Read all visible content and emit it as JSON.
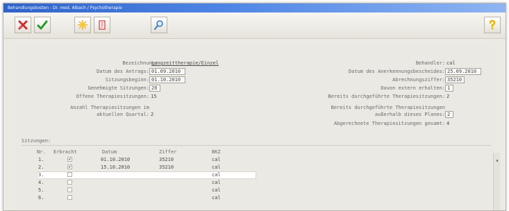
{
  "window": {
    "title": "Behandlungskosten - Dr. med. Albach / Psychotherapie"
  },
  "toolbar": {
    "buttons": [
      {
        "name": "delete-button",
        "icon": "red-x-icon"
      },
      {
        "name": "confirm-button",
        "icon": "green-check-icon"
      },
      {
        "name": "new-button",
        "icon": "yellow-burst-icon"
      },
      {
        "name": "print-button",
        "icon": "red-document-icon"
      },
      {
        "name": "search-button",
        "icon": "magnifier-icon"
      },
      {
        "name": "help-button",
        "icon": "question-mark-icon"
      }
    ]
  },
  "form": {
    "bezeichnung": {
      "label": "Bezeichnung:",
      "value": "Langzeittherapie/Einzel"
    },
    "datum_antrag": {
      "label": "Datum des Antrags:",
      "value": "01.09.2010"
    },
    "sitzungsbeginn": {
      "label": "Sitzungsbeginn:",
      "value": "01.10.2010"
    },
    "genehmigte": {
      "label": "Genehmigte Sitzungen:",
      "value": "20"
    },
    "offene": {
      "label": "Offene Therapiesitzungen:",
      "value": "15"
    },
    "anzahl_quartal": {
      "label_line1": "Anzahl Therapiesitzungen im",
      "label_line2": "aktuellen Quartal:",
      "value": "2"
    },
    "behandler": {
      "label": "Behandler:",
      "value": "cal"
    },
    "datum_anerkennung": {
      "label": "Datum des Anerkennungsbescheides:",
      "value": "25.09.2010"
    },
    "abrechnungsziffer": {
      "label": "Abrechnungsziffer:",
      "value": "35210"
    },
    "davon_extern": {
      "label": "Davon extern erhalten:",
      "value": "1"
    },
    "bereits_durchgefuehrt": {
      "label": "Bereits durchgeführte Therapiesitzungen:",
      "value": "2"
    },
    "ausserhalb": {
      "label_line1": "Bereits durchgeführte Therapiesitzungen",
      "label_line2": "außerhalb dieses Planes:",
      "value": "2"
    },
    "abgerechnet": {
      "label": "Abgerechnete Therapiesitzungen gesamt:",
      "value": "4"
    }
  },
  "sitzungen": {
    "title": "Sitzungen:",
    "columns": [
      "Nr.",
      "Erbracht",
      "Datum",
      "Ziffer",
      "BKZ"
    ],
    "rows": [
      {
        "nr": "1.",
        "erbracht": true,
        "datum": "01.10.2010",
        "ziffer": "35210",
        "bkz": "cal"
      },
      {
        "nr": "2.",
        "erbracht": true,
        "datum": "15.10.2010",
        "ziffer": "35210",
        "bkz": "cal"
      },
      {
        "nr": "3.",
        "erbracht": false,
        "datum": "",
        "ziffer": "",
        "bkz": "cal"
      },
      {
        "nr": "4.",
        "erbracht": false,
        "datum": "",
        "ziffer": "",
        "bkz": "cal"
      },
      {
        "nr": "5.",
        "erbracht": false,
        "datum": "",
        "ziffer": "",
        "bkz": "cal"
      },
      {
        "nr": "6.",
        "erbracht": false,
        "datum": "",
        "ziffer": "",
        "bkz": "cal"
      }
    ]
  }
}
